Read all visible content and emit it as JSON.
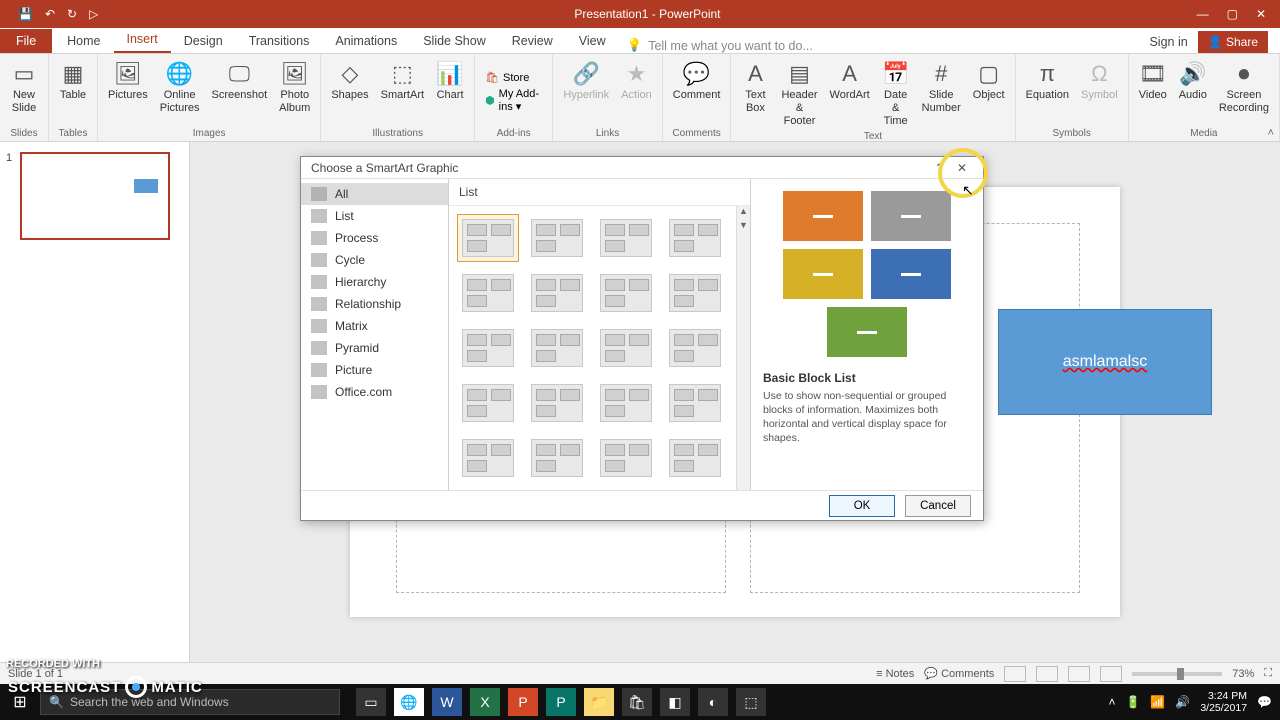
{
  "titlebar": {
    "title": "Presentation1 - PowerPoint"
  },
  "tabs": {
    "file": "File",
    "items": [
      "Home",
      "Insert",
      "Design",
      "Transitions",
      "Animations",
      "Slide Show",
      "Review",
      "View"
    ],
    "active": "Insert",
    "tellme": "Tell me what you want to do...",
    "signin": "Sign in",
    "share": "Share"
  },
  "ribbon": {
    "groups": [
      {
        "label": "Slides",
        "buttons": [
          {
            "name": "new-slide",
            "text": "New\nSlide",
            "glyph": "▭"
          }
        ]
      },
      {
        "label": "Tables",
        "buttons": [
          {
            "name": "table",
            "text": "Table",
            "glyph": "▦"
          }
        ]
      },
      {
        "label": "Images",
        "buttons": [
          {
            "name": "pictures",
            "text": "Pictures",
            "glyph": "🖼"
          },
          {
            "name": "online-pictures",
            "text": "Online\nPictures",
            "glyph": "🌐"
          },
          {
            "name": "screenshot",
            "text": "Screenshot",
            "glyph": "🖵"
          },
          {
            "name": "photo-album",
            "text": "Photo\nAlbum",
            "glyph": "🖼"
          }
        ]
      },
      {
        "label": "Illustrations",
        "buttons": [
          {
            "name": "shapes",
            "text": "Shapes",
            "glyph": "◇"
          },
          {
            "name": "smartart",
            "text": "SmartArt",
            "glyph": "⬚"
          },
          {
            "name": "chart",
            "text": "Chart",
            "glyph": "📊"
          }
        ]
      },
      {
        "label": "Add-ins",
        "store": "Store",
        "myaddins": "My Add-ins"
      },
      {
        "label": "Links",
        "buttons": [
          {
            "name": "hyperlink",
            "text": "Hyperlink",
            "glyph": "🔗",
            "disabled": true
          },
          {
            "name": "action",
            "text": "Action",
            "glyph": "★",
            "disabled": true
          }
        ]
      },
      {
        "label": "Comments",
        "buttons": [
          {
            "name": "comment",
            "text": "Comment",
            "glyph": "💬"
          }
        ]
      },
      {
        "label": "Text",
        "buttons": [
          {
            "name": "text-box",
            "text": "Text\nBox",
            "glyph": "A"
          },
          {
            "name": "header-footer",
            "text": "Header\n& Footer",
            "glyph": "▤"
          },
          {
            "name": "wordart",
            "text": "WordArt",
            "glyph": "A"
          },
          {
            "name": "date-time",
            "text": "Date &\nTime",
            "glyph": "📅"
          },
          {
            "name": "slide-number",
            "text": "Slide\nNumber",
            "glyph": "#"
          },
          {
            "name": "object",
            "text": "Object",
            "glyph": "▢"
          }
        ]
      },
      {
        "label": "Symbols",
        "buttons": [
          {
            "name": "equation",
            "text": "Equation",
            "glyph": "π"
          },
          {
            "name": "symbol",
            "text": "Symbol",
            "glyph": "Ω",
            "disabled": true
          }
        ]
      },
      {
        "label": "Media",
        "buttons": [
          {
            "name": "video",
            "text": "Video",
            "glyph": "🎞"
          },
          {
            "name": "audio",
            "text": "Audio",
            "glyph": "🔊"
          },
          {
            "name": "screen-recording",
            "text": "Screen\nRecording",
            "glyph": "⏺"
          }
        ]
      }
    ]
  },
  "slide": {
    "num": "1",
    "textbox": "asmlamalsc"
  },
  "dialog": {
    "title": "Choose a SmartArt Graphic",
    "categories": [
      "All",
      "List",
      "Process",
      "Cycle",
      "Hierarchy",
      "Relationship",
      "Matrix",
      "Pyramid",
      "Picture",
      "Office.com"
    ],
    "selected_category": "All",
    "gallery_header": "List",
    "preview": {
      "title": "Basic Block List",
      "desc": "Use to show non-sequential or grouped blocks of information. Maximizes both horizontal and vertical display space for shapes.",
      "colors": [
        "#dd7a2b",
        "#9a9a9a",
        "#d6b128",
        "#3c6fb4",
        "#6fa23c"
      ]
    },
    "ok": "OK",
    "cancel": "Cancel",
    "help": "?",
    "close": "✕"
  },
  "statusbar": {
    "left": "Slide 1 of 1",
    "notes": "Notes",
    "comments": "Comments",
    "zoom": "73%"
  },
  "taskbar": {
    "search_placeholder": "Search the web and Windows",
    "time": "3:24 PM",
    "date": "3/25/2017"
  },
  "watermark": {
    "rec": "RECORDED WITH",
    "brand1": "SCREENCAST",
    "brand2": "MATIC"
  }
}
